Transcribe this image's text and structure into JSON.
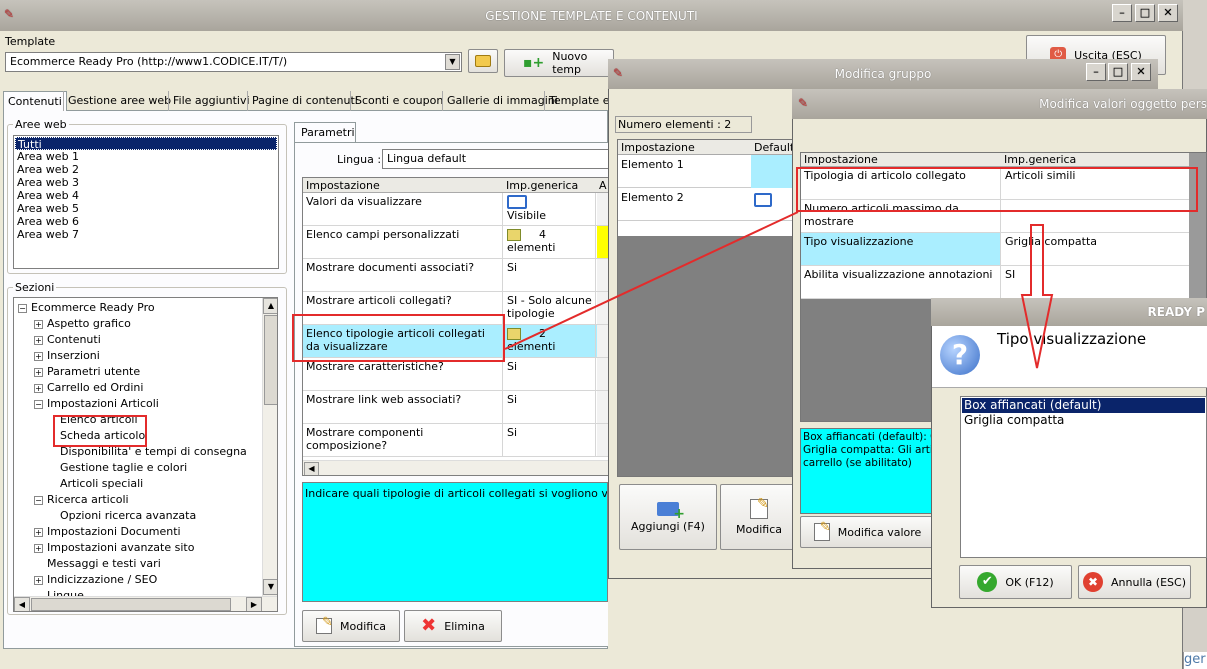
{
  "main": {
    "title": "GESTIONE TEMPLATE E CONTENUTI",
    "template_label": "Template",
    "template_value": "Ecommerce Ready Pro (http://www1.CODICE.IT/T/)",
    "new_template": "Nuovo temp",
    "exit": "Uscita (ESC)",
    "tabs": [
      "Contenuti",
      "Gestione aree web",
      "File aggiuntivi",
      "Pagine di contenuti",
      "Sconti e coupon",
      "Gallerie di immagini",
      "Template e p"
    ],
    "aree_web_label": "Aree web",
    "aree_web": [
      "Tutti",
      "Area web 1",
      "Area web 2",
      "Area web 3",
      "Area web 4",
      "Area web 5",
      "Area web 6",
      "Area web 7"
    ],
    "sezioni_label": "Sezioni",
    "tree": [
      {
        "label": "Ecommerce Ready Pro",
        "sign": "−"
      },
      {
        "label": "Aspetto grafico",
        "sign": "+"
      },
      {
        "label": "Contenuti",
        "sign": "+"
      },
      {
        "label": "Inserzioni",
        "sign": "+"
      },
      {
        "label": "Parametri utente",
        "sign": "+"
      },
      {
        "label": "Carrello ed Ordini",
        "sign": "+"
      },
      {
        "label": "Impostazioni Articoli",
        "sign": "−"
      },
      {
        "label": "Elenco articoli",
        "sign": ""
      },
      {
        "label": "Scheda articolo",
        "sign": ""
      },
      {
        "label": "Disponibilita' e tempi di consegna",
        "sign": ""
      },
      {
        "label": "Gestione taglie e colori",
        "sign": ""
      },
      {
        "label": "Articoli speciali",
        "sign": ""
      },
      {
        "label": "Ricerca articoli",
        "sign": "−"
      },
      {
        "label": "Opzioni ricerca avanzata",
        "sign": ""
      },
      {
        "label": "Impostazioni Documenti",
        "sign": "+"
      },
      {
        "label": "Impostazioni avanzate sito",
        "sign": "+"
      },
      {
        "label": "Messaggi e testi vari",
        "sign": ""
      },
      {
        "label": "Indicizzazione / SEO",
        "sign": "+"
      },
      {
        "label": "Lingue",
        "sign": ""
      }
    ],
    "parametri_tab": "Parametri",
    "lingua_label": "Lingua :",
    "lingua_value": "Lingua default",
    "grid_headers": [
      "Impostazione",
      "Imp.generica",
      "A"
    ],
    "grid_rows": [
      {
        "name": "Valori da visualizzare",
        "value": "Visibile"
      },
      {
        "name": "Elenco campi personalizzati",
        "value": "4 elementi"
      },
      {
        "name": "Mostrare documenti associati?",
        "value": "Si"
      },
      {
        "name": "Mostrare articoli collegati?",
        "value": "SI - Solo alcune tipologie"
      },
      {
        "name": "Elenco tipologie articoli collegati da visualizzare",
        "value": "2 elementi"
      },
      {
        "name": "Mostrare caratteristiche?",
        "value": "Si"
      },
      {
        "name": "Mostrare link web associati?",
        "value": "Si"
      },
      {
        "name": "Mostrare componenti composizione?",
        "value": "Si"
      }
    ],
    "description": "Indicare quali tipologie di articoli collegati si vogliono visualizzare",
    "modifica": "Modifica",
    "elimina": "Elimina",
    "bottom_fragment": "ger"
  },
  "gruppo": {
    "title": "Modifica gruppo",
    "count": "Numero elementi : 2",
    "headers": [
      "Impostazione",
      "Default"
    ],
    "rows": [
      "Elemento 1",
      "Elemento 2"
    ],
    "aggiungi": "Aggiungi (F4)",
    "modifica": "Modifica"
  },
  "valori": {
    "title": "Modifica valori oggetto pers",
    "headers": [
      "Impostazione",
      "Imp.generica"
    ],
    "rows": [
      {
        "name": "Tipologia di articolo collegato",
        "value": "Articoli simili"
      },
      {
        "name": "Numero articoli massimo da mostrare",
        "value": ""
      },
      {
        "name": "Tipo visualizzazione",
        "value": "Griglia compatta"
      },
      {
        "name": "Abilita visualizzazione annotazioni",
        "value": "SI"
      }
    ],
    "info_lines": [
      "Box affiancati (default): Gli",
      "Griglia compatta: Gli articoli",
      "carrello (se abilitato)"
    ],
    "modifica_valore": "Modifica valore"
  },
  "dialog": {
    "title": "READY P",
    "question": "Tipo visualizzazione",
    "options": [
      "Box affiancati (default)",
      "Griglia compatta"
    ],
    "ok": "OK (F12)",
    "cancel": "Annulla (ESC)"
  },
  "colors": {
    "accent_red": "#e32b2b",
    "cyan": "#00ffff",
    "selection": "#0a246a"
  }
}
